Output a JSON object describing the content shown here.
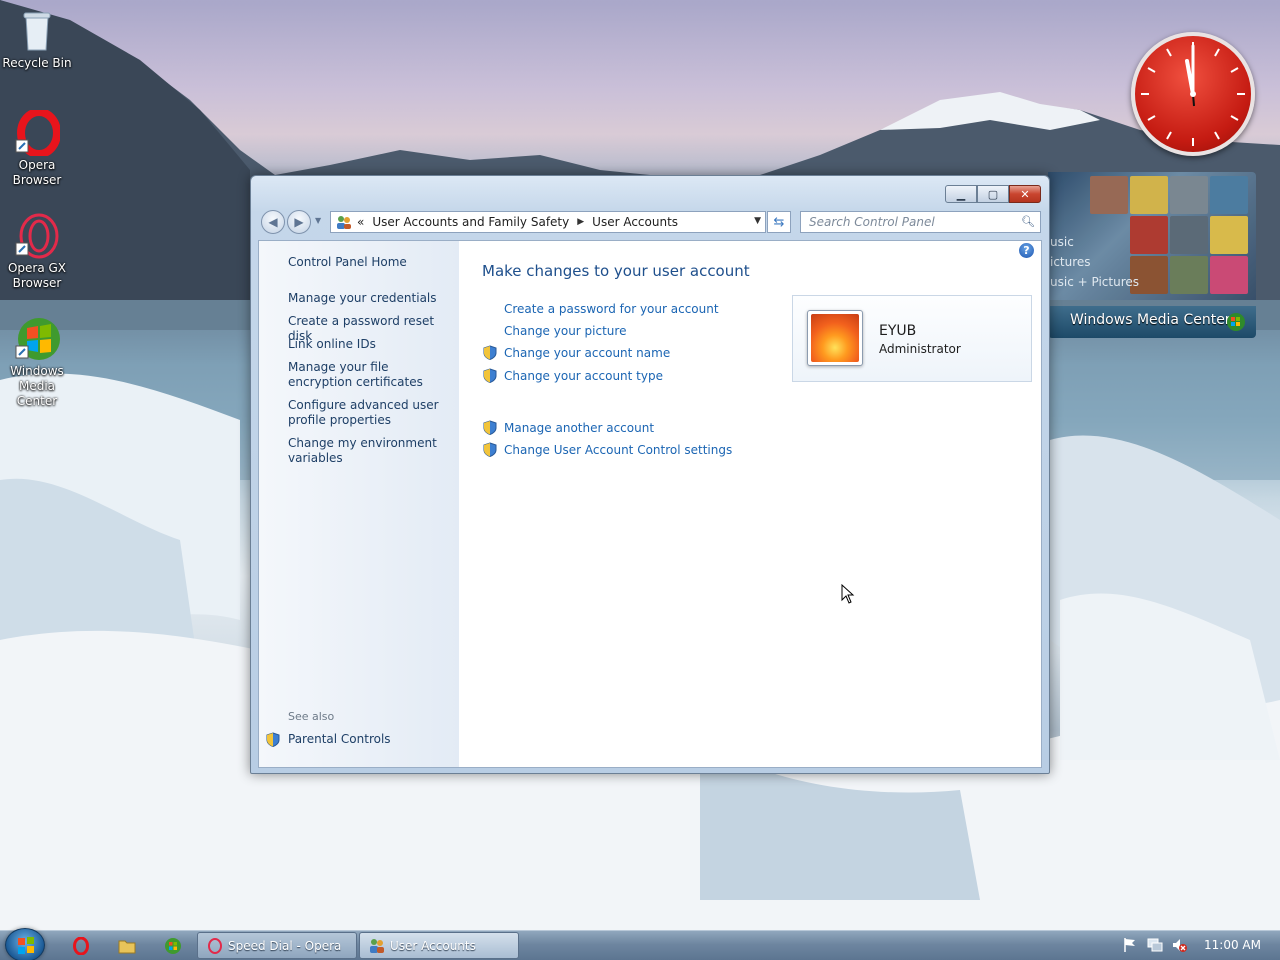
{
  "desktop": {
    "icons": [
      {
        "label_line1": "Recycle Bin",
        "label_line2": ""
      },
      {
        "label_line1": "Opera",
        "label_line2": "Browser"
      },
      {
        "label_line1": "Opera GX",
        "label_line2": "Browser"
      },
      {
        "label_line1": "Windows",
        "label_line2": "Media Center"
      }
    ]
  },
  "window": {
    "breadcrumb": {
      "overflow": "«",
      "segments": [
        "User Accounts and Family Safety",
        "User Accounts"
      ]
    },
    "search_placeholder": "Search Control Panel",
    "help": "?",
    "sidebar": {
      "home": "Control Panel Home",
      "links": [
        "Manage your credentials",
        "Create a password reset disk",
        "Link online IDs",
        "Manage your file encryption certificates",
        "Configure advanced user profile properties",
        "Change my environment variables"
      ],
      "see_also_title": "See also",
      "see_also_links": [
        "Parental Controls"
      ]
    },
    "main": {
      "title": "Make changes to your user account",
      "tasks": [
        "Create a password for your account",
        "Change your picture",
        "Change your account name",
        "Change your account type"
      ],
      "other_tasks": [
        "Manage another account",
        "Change User Account Control settings"
      ]
    },
    "account": {
      "name": "EYUB",
      "role": "Administrator"
    }
  },
  "gadgets": {
    "wmc": {
      "items": [
        "usic",
        "ictures",
        "usic + Pictures"
      ],
      "brand": "Windows Media Center"
    }
  },
  "taskbar": {
    "buttons": [
      "Speed Dial - Opera",
      "User Accounts"
    ],
    "clock": "11:00 AM"
  },
  "colors": {
    "link": "#1b65b3",
    "title": "#1e4f8c",
    "close_red": "#c9452f"
  }
}
